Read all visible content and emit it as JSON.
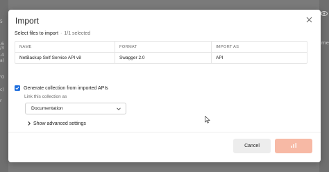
{
  "background": {
    "left_fragments": [
      "5",
      ".6",
      "/3",
      ".4",
      "a)",
      "'O",
      "c)",
      "r"
    ],
    "right_text": "me"
  },
  "modal": {
    "title": "Import",
    "close_icon": "close-icon",
    "files_heading": "Select files to import",
    "separator": "·",
    "selected_count": "1/1 selected",
    "table": {
      "headers": [
        "NAME",
        "FORMAT",
        "IMPORT AS"
      ],
      "rows": [
        [
          "NetBackup Self Service API v8",
          "Swagger 2.0",
          "API"
        ]
      ]
    },
    "generate_collection": {
      "checked": true,
      "label": "Generate collection from imported APIs"
    },
    "link_label": "Link this collection as",
    "link_select_value": "Documentation",
    "advanced_label": "Show advanced settings",
    "buttons": {
      "cancel": "Cancel",
      "import_state": "loading"
    }
  },
  "colors": {
    "accent": "#1f6fde",
    "primary_disabled": "#f7b9a5",
    "overlay": "#7a7a7a"
  }
}
